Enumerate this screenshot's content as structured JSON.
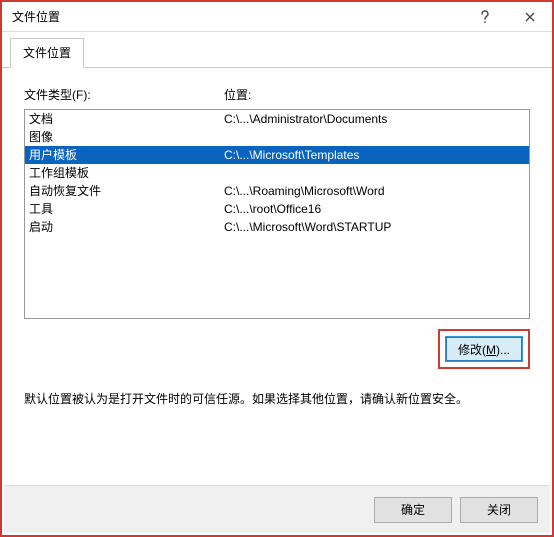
{
  "window": {
    "title": "文件位置"
  },
  "tab": {
    "label": "文件位置"
  },
  "headers": {
    "file_type": "文件类型(F):",
    "location": "位置:"
  },
  "rows": [
    {
      "type": "文档",
      "location": "C:\\...\\Administrator\\Documents",
      "selected": false
    },
    {
      "type": "图像",
      "location": "",
      "selected": false
    },
    {
      "type": "用户模板",
      "location": "C:\\...\\Microsoft\\Templates",
      "selected": true
    },
    {
      "type": "工作组模板",
      "location": "",
      "selected": false
    },
    {
      "type": "自动恢复文件",
      "location": "C:\\...\\Roaming\\Microsoft\\Word",
      "selected": false
    },
    {
      "type": "工具",
      "location": "C:\\...\\root\\Office16",
      "selected": false
    },
    {
      "type": "启动",
      "location": "C:\\...\\Microsoft\\Word\\STARTUP",
      "selected": false
    }
  ],
  "buttons": {
    "modify_prefix": "修改(",
    "modify_key": "M",
    "modify_suffix": ")...",
    "ok": "确定",
    "close": "关闭"
  },
  "note": {
    "text": "默认位置被认为是打开文件时的可信任源。如果选择其他位置，请确认新位置安全。"
  }
}
